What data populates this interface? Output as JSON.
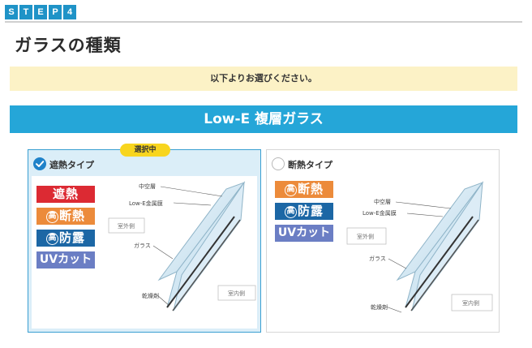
{
  "step": {
    "letters": [
      "S",
      "T",
      "E",
      "P",
      "4"
    ]
  },
  "page_title": "ガラスの種類",
  "notice": "以下よりお選びください。",
  "section_title": "Low-E 複層ガラス",
  "cards": [
    {
      "title": "遮熱タイプ",
      "selected": true,
      "badge": "選択中",
      "features": [
        {
          "text": "遮熱",
          "style": "red"
        },
        {
          "prefix": "高",
          "text": "断熱",
          "style": "orange"
        },
        {
          "prefix": "高",
          "text": "防露",
          "style": "blue"
        },
        {
          "text": "UVカット",
          "style": "purple"
        }
      ],
      "diagram": {
        "air_layer": "中空層",
        "metal_film": "Low-E金属膜",
        "outdoor": "室外側",
        "glass": "ガラス",
        "desiccant": "乾燥剤",
        "indoor": "室内側"
      }
    },
    {
      "title": "断熱タイプ",
      "selected": false,
      "features": [
        {
          "prefix": "高",
          "text": "断熱",
          "style": "orange"
        },
        {
          "prefix": "高",
          "text": "防露",
          "style": "blue"
        },
        {
          "text": "UVカット",
          "style": "purple"
        }
      ],
      "diagram": {
        "air_layer": "中空層",
        "metal_film": "Low-E金属膜",
        "outdoor": "室外側",
        "glass": "ガラス",
        "desiccant": "乾燥剤",
        "indoor": "室内側"
      }
    }
  ],
  "colors": {
    "step": "#1f93c7",
    "header": "#25a6d8",
    "notice_bg": "#fcf2c6",
    "badge": "#f8d51e",
    "red": "#dc2a33",
    "orange": "#ec8b3b",
    "blue": "#1c67a5",
    "purple": "#6b7ec4"
  }
}
